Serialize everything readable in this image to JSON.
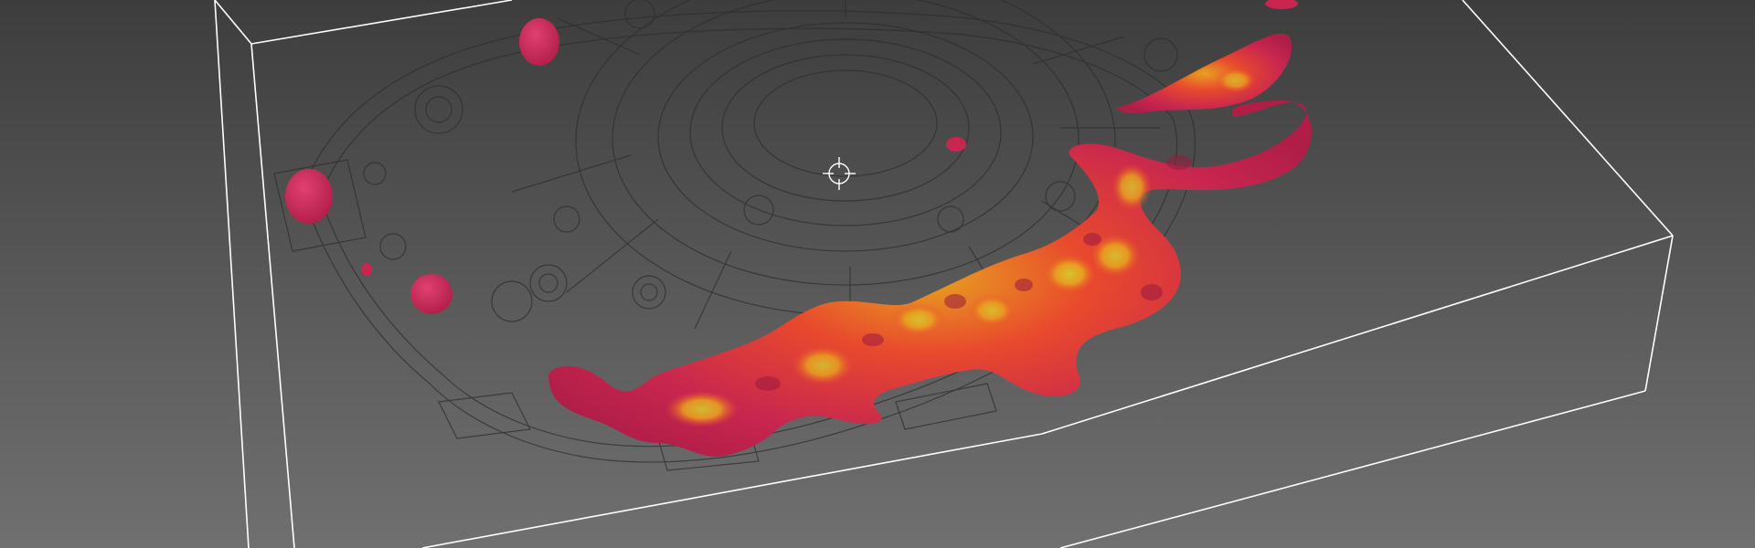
{
  "viewport": {
    "kind": "3d-render",
    "background_colors": [
      "#3c3c3c",
      "#6e6e6e"
    ],
    "bounding_box_color": "#ffffff",
    "part_wireframe_color": "#2e2e2e",
    "defect_colors": {
      "low": "#c8264f",
      "mid": "#e8492d",
      "high": "#e8a020",
      "peak": "#d4c830"
    },
    "cursor_icon": "crosshair-icon"
  }
}
